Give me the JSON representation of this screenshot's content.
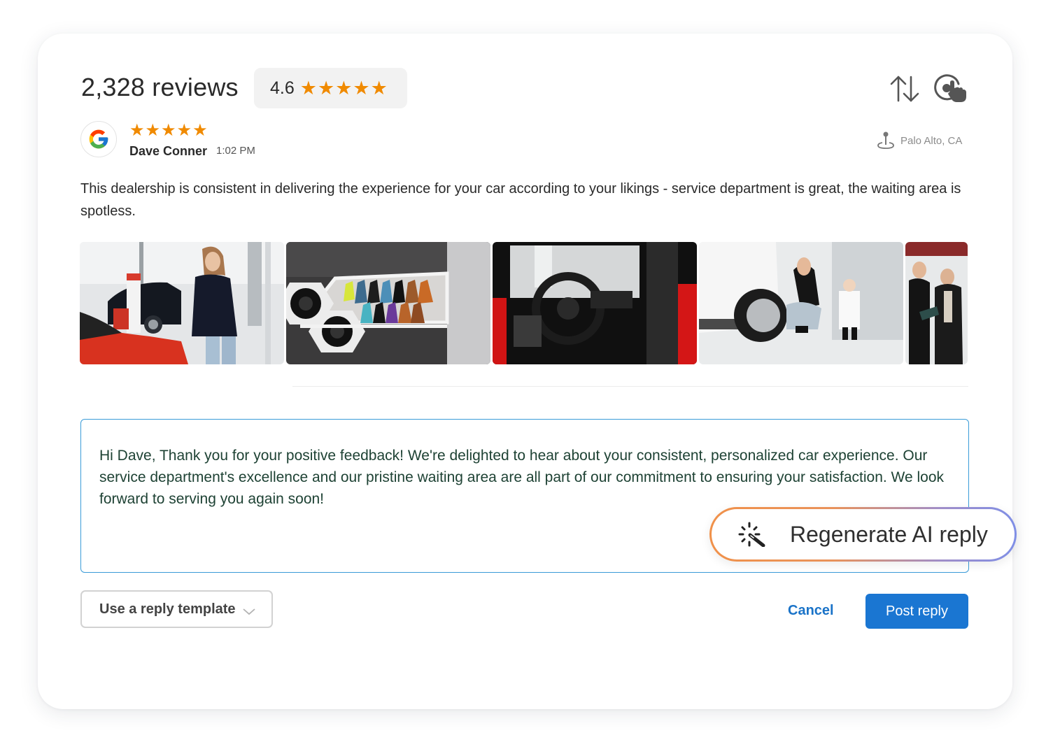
{
  "header": {
    "review_count": "2,328 reviews",
    "average_rating": "4.6",
    "average_stars": 5,
    "sort_icon": "sort-arrows-icon",
    "engage_icon": "tap-target-icon"
  },
  "review": {
    "source_icon": "google-logo-icon",
    "stars": 5,
    "reviewer_name": "Dave Conner",
    "time": "1:02 PM",
    "location_icon": "map-pin-icon",
    "location": "Palo Alto, CA",
    "text": "This dealership is consistent in delivering the experience for your car according to your likings -  service department is great, the waiting area is spotless.",
    "photos": [
      {
        "name": "showroom-woman-photo"
      },
      {
        "name": "leather-samples-wall-photo"
      },
      {
        "name": "sports-car-interior-photo"
      },
      {
        "name": "mother-child-tire-photo"
      },
      {
        "name": "salesman-customer-photo"
      }
    ]
  },
  "reply": {
    "text": "Hi Dave, Thank you for your positive feedback! We're delighted to hear about your consistent, personalized car experience. Our service department's excellence and our pristine waiting area are all part of our commitment to ensuring your satisfaction. We look forward to serving you again soon!",
    "regenerate_label": "Regenerate AI reply",
    "regenerate_icon": "magic-wand-sparkle-icon"
  },
  "actions": {
    "template_label": "Use a reply template",
    "cancel_label": "Cancel",
    "post_label": "Post reply"
  },
  "colors": {
    "star": "#f08a00",
    "primary": "#1a76d2",
    "reply_border": "#3a9bd8",
    "reply_text": "#1e4234"
  }
}
